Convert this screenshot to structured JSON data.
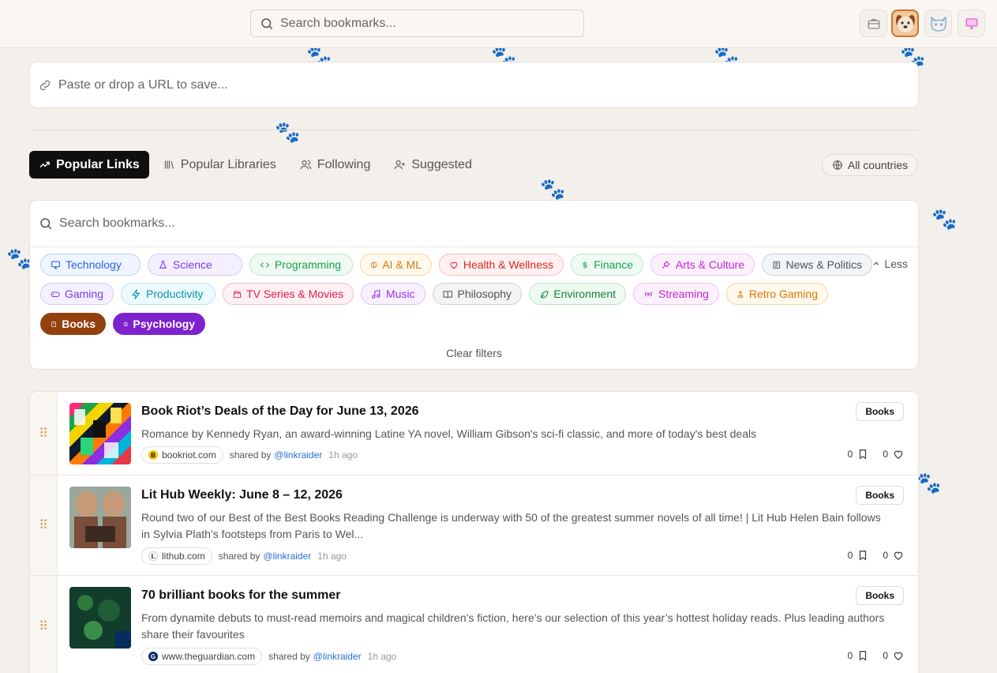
{
  "header": {
    "search_placeholder": "Search bookmarks...",
    "theme_buttons": [
      {
        "name": "briefcase-icon"
      },
      {
        "name": "dog-theme-icon",
        "active": true
      },
      {
        "name": "cat-theme-icon"
      },
      {
        "name": "monitor-theme-icon"
      }
    ]
  },
  "url_input": {
    "placeholder": "Paste or drop a URL to save..."
  },
  "tabs": [
    {
      "label": "Popular Links",
      "icon": "trending-up-icon",
      "active": true
    },
    {
      "label": "Popular Libraries",
      "icon": "library-icon"
    },
    {
      "label": "Following",
      "icon": "users-icon"
    },
    {
      "label": "Suggested",
      "icon": "user-plus-icon"
    }
  ],
  "country_filter": {
    "label": "All countries",
    "icon": "globe-icon"
  },
  "library": {
    "search_placeholder": "Search bookmarks...",
    "less_label": "Less",
    "clear_label": "Clear filters",
    "categories": [
      {
        "label": "Technology",
        "icon": "monitor-icon",
        "color": "#2563eb",
        "bg": "#eff5ff",
        "border": "#b9d2f5"
      },
      {
        "label": "Science",
        "icon": "flask-icon",
        "color": "#7c3aed",
        "bg": "#f5f0ff",
        "border": "#d8c8f5"
      },
      {
        "label": "Programming",
        "icon": "code-icon",
        "color": "#16a34a",
        "bg": "#effaf2",
        "border": "#bfe6cb"
      },
      {
        "label": "AI & ML",
        "icon": "brain-icon",
        "color": "#d97706",
        "bg": "#fff8ec",
        "border": "#f1d6a6"
      },
      {
        "label": "Health & Wellness",
        "icon": "heart-icon",
        "color": "#dc2626",
        "bg": "#fff1f1",
        "border": "#f3c2c2"
      },
      {
        "label": "Finance",
        "icon": "dollar-icon",
        "color": "#16a34a",
        "bg": "#effaf2",
        "border": "#bfe6cb"
      },
      {
        "label": "Arts & Culture",
        "icon": "palette-icon",
        "color": "#c026d3",
        "bg": "#fdf0fd",
        "border": "#efc2f2"
      },
      {
        "label": "News & Politics",
        "icon": "newspaper-icon",
        "color": "#475569",
        "bg": "#f3f5f7",
        "border": "#cdd3da"
      },
      {
        "label": "Gaming",
        "icon": "gamepad-icon",
        "color": "#7c3aed",
        "bg": "#f5f0ff",
        "border": "#d8c8f5"
      },
      {
        "label": "Productivity",
        "icon": "zap-icon",
        "color": "#0891b2",
        "bg": "#ecfafd",
        "border": "#b6e3ee"
      },
      {
        "label": "TV Series & Movies",
        "icon": "clapperboard-icon",
        "color": "#e11d48",
        "bg": "#fff0f3",
        "border": "#f3bfca"
      },
      {
        "label": "Music",
        "icon": "music-icon",
        "color": "#9333ea",
        "bg": "#f8f0ff",
        "border": "#dcc4f5"
      },
      {
        "label": "Philosophy",
        "icon": "book-open-icon",
        "color": "#525252",
        "bg": "#f4f4f4",
        "border": "#d2d2d2"
      },
      {
        "label": "Environment",
        "icon": "leaf-icon",
        "color": "#15803d",
        "bg": "#eefaf1",
        "border": "#bde3c6"
      },
      {
        "label": "Streaming",
        "icon": "radio-icon",
        "color": "#c026d3",
        "bg": "#fdf0fd",
        "border": "#efc2f2"
      },
      {
        "label": "Retro Gaming",
        "icon": "joystick-icon",
        "color": "#d97706",
        "bg": "#fff8ec",
        "border": "#f1d6a6"
      },
      {
        "label": "Books",
        "icon": "book-icon",
        "color": "#ffffff",
        "bg": "#92400e",
        "border": "#92400e",
        "active": true
      },
      {
        "label": "Psychology",
        "icon": "brain-icon",
        "color": "#ffffff",
        "bg": "#7e22ce",
        "border": "#7e22ce",
        "active": true
      }
    ]
  },
  "bookmarks": [
    {
      "title": "Book Riot’s Deals of the Day for June 13, 2026",
      "description": "Romance by Kennedy Ryan, an award-winning Latine YA novel, William Gibson's sci-fi classic, and more of today's best deals",
      "domain": "bookriot.com",
      "shared_by_label": "shared by",
      "user": "@linkraider",
      "time": "1h ago",
      "tag": "Books",
      "saves": "0",
      "likes": "0"
    },
    {
      "title": "Lit Hub Weekly: June 8 – 12, 2026",
      "description": "Round two of our Best of the Best Books Reading Challenge is underway with 50 of the greatest summer novels of all time! | Lit Hub Helen Bain follows in Sylvia Plath’s footsteps from Paris to Wel...",
      "domain": "lithub.com",
      "shared_by_label": "shared by",
      "user": "@linkraider",
      "time": "1h ago",
      "tag": "Books",
      "saves": "0",
      "likes": "0"
    },
    {
      "title": "70 brilliant books for the summer",
      "description": "From dynamite debuts to must-read memoirs and magical children’s fiction, here’s our selection of this year’s hottest holiday reads. Plus leading authors share their favourites",
      "domain": "www.theguardian.com",
      "shared_by_label": "shared by",
      "user": "@linkraider",
      "time": "1h ago",
      "tag": "Books",
      "saves": "0",
      "likes": "0"
    }
  ]
}
